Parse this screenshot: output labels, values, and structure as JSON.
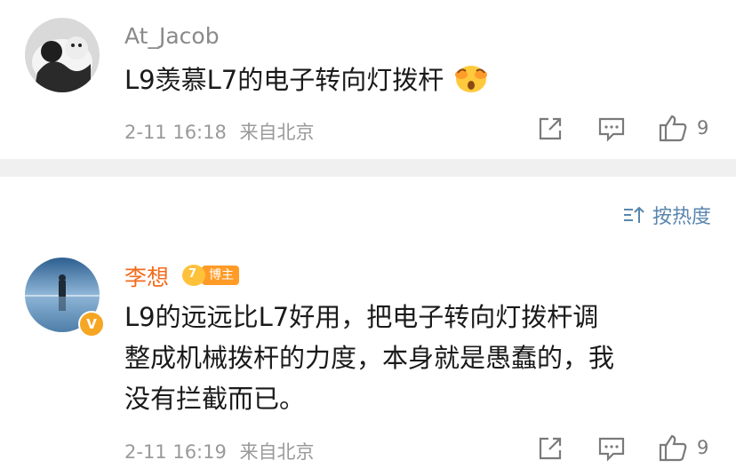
{
  "comments": [
    {
      "username": "At_Jacob",
      "text": "L9羡慕L7的电子转向灯拨杆",
      "emoji": "scared-face-emoji",
      "timestamp": "2-11 16:18",
      "location": "来自北京",
      "likes": "9"
    },
    {
      "username": "李想",
      "badge_label": "博主",
      "badge_level": "7",
      "verified_mark": "V",
      "text_lines": [
        "L9的远远比L7好用，把电子转向灯拨杆调",
        "整成机械拨杆的力度，本身就是愚蠢的，我",
        "没有拦截而已。"
      ],
      "timestamp": "2-11 16:19",
      "location": "来自北京",
      "likes": "9"
    }
  ],
  "sort": {
    "label": "按热度"
  },
  "colors": {
    "username": "#8a8a8a",
    "verified_username": "#f26b1d",
    "link": "#5a86ad",
    "divider": "#f0f0f0"
  }
}
